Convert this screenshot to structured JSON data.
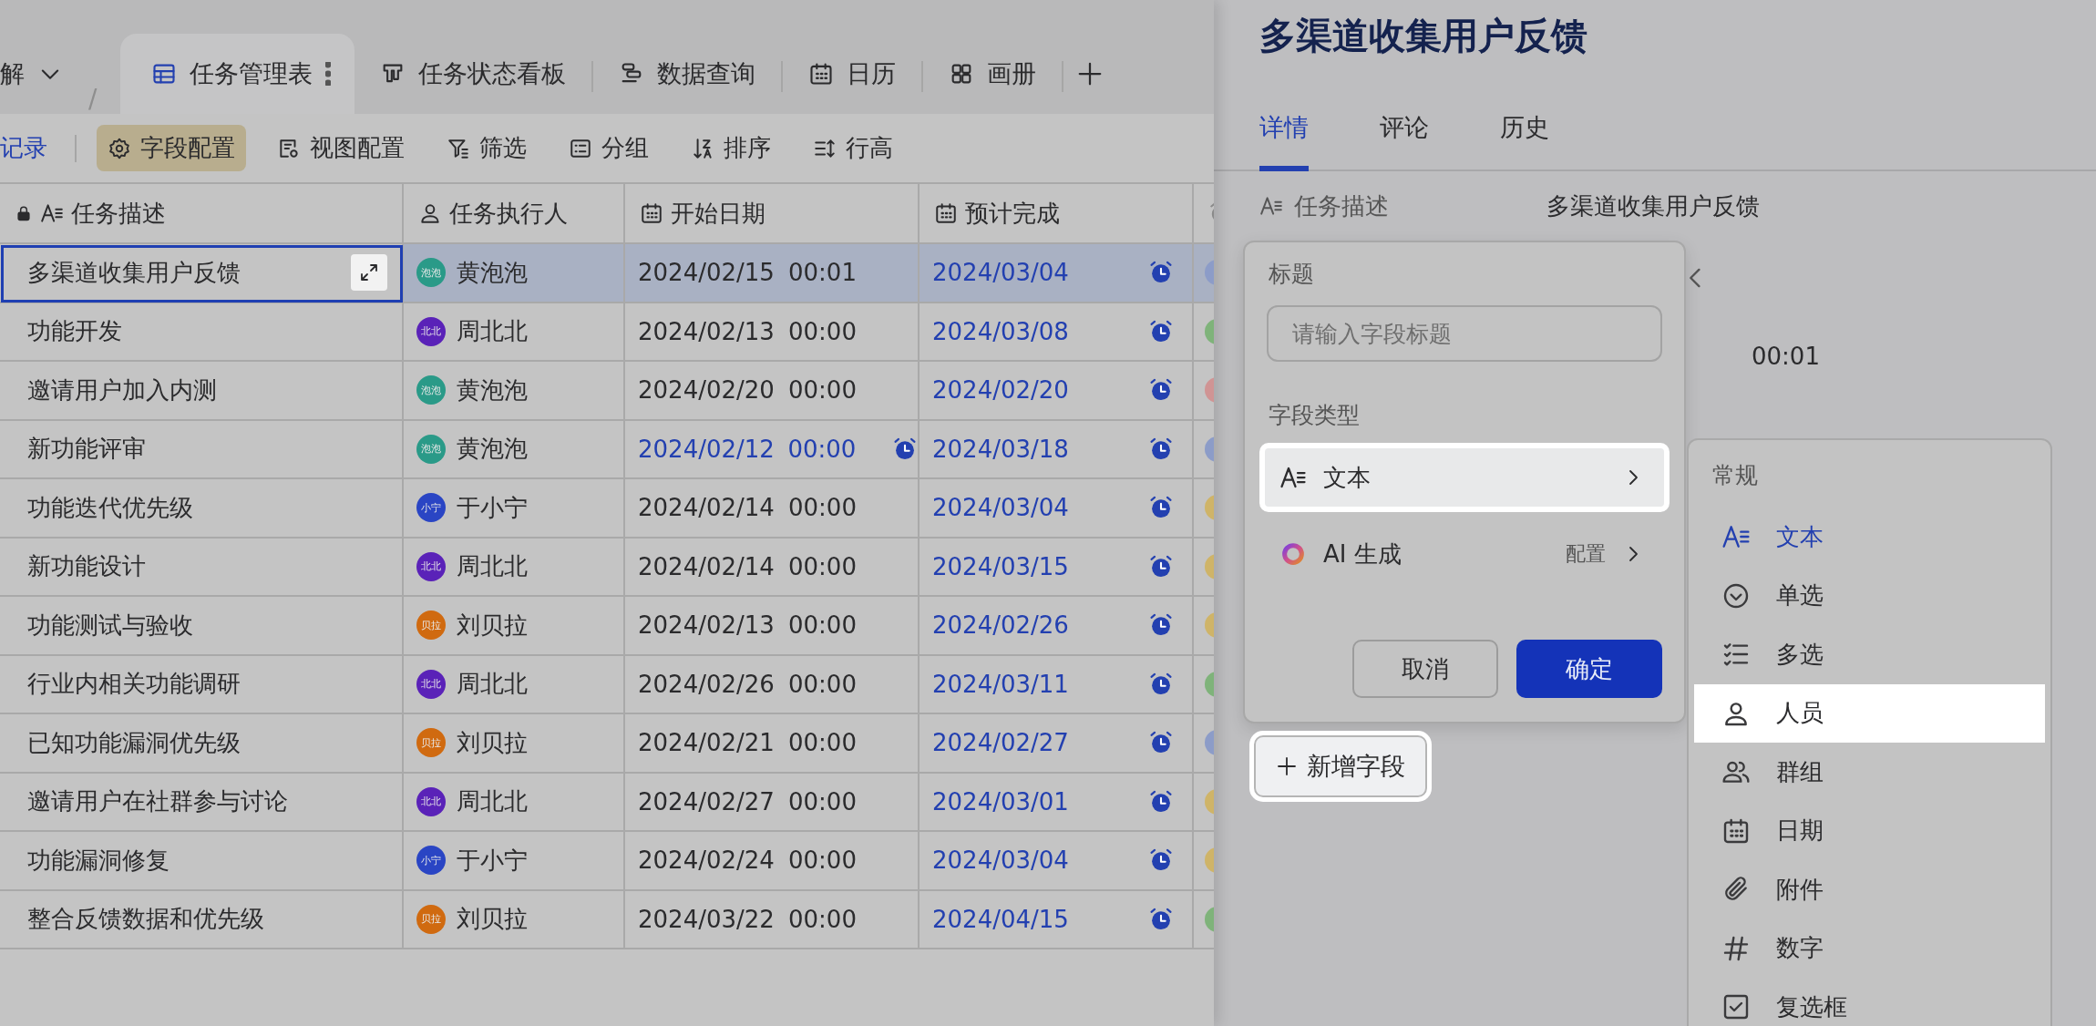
{
  "breadcrumb": {
    "label": "解",
    "separator": "/"
  },
  "view_tabs": [
    {
      "label": "任务管理表",
      "selected": true
    },
    {
      "label": "任务状态看板",
      "selected": false
    },
    {
      "label": "数据查询",
      "selected": false
    },
    {
      "label": "日历",
      "selected": false
    },
    {
      "label": "画册",
      "selected": false
    }
  ],
  "add_record_link": {
    "label": "记录"
  },
  "toolbar": [
    {
      "label": "字段配置",
      "selected": true
    },
    {
      "label": "视图配置",
      "selected": false
    },
    {
      "label": "筛选",
      "selected": false
    },
    {
      "label": "分组",
      "selected": false
    },
    {
      "label": "排序",
      "selected": false
    },
    {
      "label": "行高",
      "selected": false
    }
  ],
  "table": {
    "columns": [
      {
        "label": "任务描述",
        "locked": true
      },
      {
        "label": "任务执行人",
        "locked": false
      },
      {
        "label": "开始日期",
        "locked": false
      },
      {
        "label": "预计完成",
        "locked": false
      }
    ],
    "rows": [
      {
        "task": "多渠道收集用户反馈",
        "selected": true,
        "assignee": {
          "avatar": "泡泡",
          "name": "黄泡泡",
          "color": "#2a9a88"
        },
        "start": {
          "date": "2024/02/15",
          "time": "00:01",
          "reminder": false
        },
        "due": {
          "date": "2024/03/04",
          "reminder": true
        },
        "color": "#8c9cc8"
      },
      {
        "task": "功能开发",
        "selected": false,
        "assignee": {
          "avatar": "北北",
          "name": "周北北",
          "color": "#5a22b8"
        },
        "start": {
          "date": "2024/02/13",
          "time": "00:00",
          "reminder": false
        },
        "due": {
          "date": "2024/03/08",
          "reminder": true
        },
        "color": "#7fb37a"
      },
      {
        "task": "邀请用户加入内测",
        "selected": false,
        "assignee": {
          "avatar": "泡泡",
          "name": "黄泡泡",
          "color": "#2a9a88"
        },
        "start": {
          "date": "2024/02/20",
          "time": "00:00",
          "reminder": false
        },
        "due": {
          "date": "2024/02/20",
          "reminder": true
        },
        "color": "#d09494"
      },
      {
        "task": "新功能评审",
        "selected": false,
        "assignee": {
          "avatar": "泡泡",
          "name": "黄泡泡",
          "color": "#2a9a88"
        },
        "start": {
          "date": "2024/02/12",
          "time": "00:00",
          "reminder": true
        },
        "due": {
          "date": "2024/03/18",
          "reminder": true
        },
        "color": "#8c9cc8"
      },
      {
        "task": "功能迭代优先级",
        "selected": false,
        "assignee": {
          "avatar": "小宁",
          "name": "于小宁",
          "color": "#2a45c4"
        },
        "start": {
          "date": "2024/02/14",
          "time": "00:00",
          "reminder": false
        },
        "due": {
          "date": "2024/03/04",
          "reminder": true
        },
        "color": "#cfb468"
      },
      {
        "task": "新功能设计",
        "selected": false,
        "assignee": {
          "avatar": "北北",
          "name": "周北北",
          "color": "#5a22b8"
        },
        "start": {
          "date": "2024/02/14",
          "time": "00:00",
          "reminder": false
        },
        "due": {
          "date": "2024/03/15",
          "reminder": true
        },
        "color": "#cfb468"
      },
      {
        "task": "功能测试与验收",
        "selected": false,
        "assignee": {
          "avatar": "贝拉",
          "name": "刘贝拉",
          "color": "#d06a10"
        },
        "start": {
          "date": "2024/02/13",
          "time": "00:00",
          "reminder": false
        },
        "due": {
          "date": "2024/02/26",
          "reminder": true
        },
        "color": "#cfb468"
      },
      {
        "task": "行业内相关功能调研",
        "selected": false,
        "assignee": {
          "avatar": "北北",
          "name": "周北北",
          "color": "#5a22b8"
        },
        "start": {
          "date": "2024/02/26",
          "time": "00:00",
          "reminder": false
        },
        "due": {
          "date": "2024/03/11",
          "reminder": true
        },
        "color": "#7fb37a"
      },
      {
        "task": "已知功能漏洞优先级",
        "selected": false,
        "assignee": {
          "avatar": "贝拉",
          "name": "刘贝拉",
          "color": "#d06a10"
        },
        "start": {
          "date": "2024/02/21",
          "time": "00:00",
          "reminder": false
        },
        "due": {
          "date": "2024/02/27",
          "reminder": true
        },
        "color": "#8c9cc8"
      },
      {
        "task": "邀请用户在社群参与讨论",
        "selected": false,
        "assignee": {
          "avatar": "北北",
          "name": "周北北",
          "color": "#5a22b8"
        },
        "start": {
          "date": "2024/02/27",
          "time": "00:00",
          "reminder": false
        },
        "due": {
          "date": "2024/03/01",
          "reminder": true
        },
        "color": "#cfb468"
      },
      {
        "task": "功能漏洞修复",
        "selected": false,
        "assignee": {
          "avatar": "小宁",
          "name": "于小宁",
          "color": "#2a45c4"
        },
        "start": {
          "date": "2024/02/24",
          "time": "00:00",
          "reminder": false
        },
        "due": {
          "date": "2024/03/04",
          "reminder": true
        },
        "color": "#cfb468"
      },
      {
        "task": "整合反馈数据和优先级",
        "selected": false,
        "assignee": {
          "avatar": "贝拉",
          "name": "刘贝拉",
          "color": "#d06a10"
        },
        "start": {
          "date": "2024/03/22",
          "time": "00:00",
          "reminder": false
        },
        "due": {
          "date": "2024/04/15",
          "reminder": true
        },
        "color": "#7fb37a"
      }
    ]
  },
  "detail": {
    "title": "多渠道收集用户反馈",
    "tabs": [
      {
        "label": "详情",
        "selected": true
      },
      {
        "label": "评论",
        "selected": false
      },
      {
        "label": "历史",
        "selected": false
      }
    ],
    "fields": [
      {
        "label": "任务描述",
        "value": "多渠道收集用户反馈"
      }
    ],
    "time_fragment": "00:01"
  },
  "field_popup": {
    "title_label": "标题",
    "title_placeholder": "请输入字段标题",
    "type_label": "字段类型",
    "types": [
      {
        "label": "文本",
        "highlighted": true
      },
      {
        "label": "AI 生成",
        "action": "配置",
        "highlighted": false
      }
    ],
    "buttons": [
      {
        "label": "取消",
        "kind": "secondary"
      },
      {
        "label": "确定",
        "kind": "primary"
      }
    ]
  },
  "add_field_button": {
    "label": "新增字段",
    "highlighted": true
  },
  "type_menu": {
    "group": "常规",
    "items": [
      {
        "label": "文本",
        "selected": true,
        "highlighted": false
      },
      {
        "label": "单选",
        "selected": false,
        "highlighted": false
      },
      {
        "label": "多选",
        "selected": false,
        "highlighted": false
      },
      {
        "label": "人员",
        "selected": false,
        "highlighted": true
      },
      {
        "label": "群组",
        "selected": false,
        "highlighted": false
      },
      {
        "label": "日期",
        "selected": false,
        "highlighted": false
      },
      {
        "label": "附件",
        "selected": false,
        "highlighted": false
      },
      {
        "label": "数字",
        "selected": false,
        "highlighted": false
      },
      {
        "label": "复选框",
        "selected": false,
        "highlighted": false
      }
    ]
  }
}
